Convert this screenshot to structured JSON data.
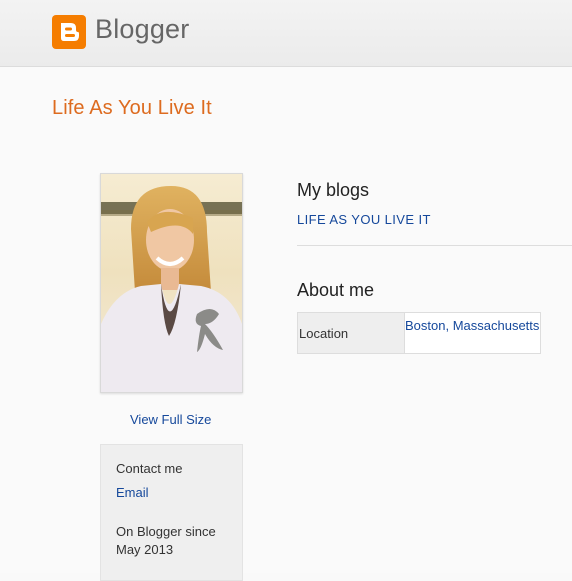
{
  "header": {
    "brand": "Blogger",
    "logo_icon": "blogger-logo-icon",
    "brand_color": "#f57d00"
  },
  "profile": {
    "blog_title": "Life As You Live It",
    "photo_icon": "profile-photo",
    "view_full_size": "View Full Size"
  },
  "contact": {
    "label": "Contact me",
    "email": "Email",
    "since": "On Blogger since May 2013"
  },
  "my_blogs": {
    "heading": "My blogs",
    "items": [
      "LIFE AS YOU LIVE IT"
    ]
  },
  "about": {
    "heading": "About me",
    "rows": [
      {
        "key": "Location",
        "value": "Boston, Massachusetts"
      }
    ]
  }
}
